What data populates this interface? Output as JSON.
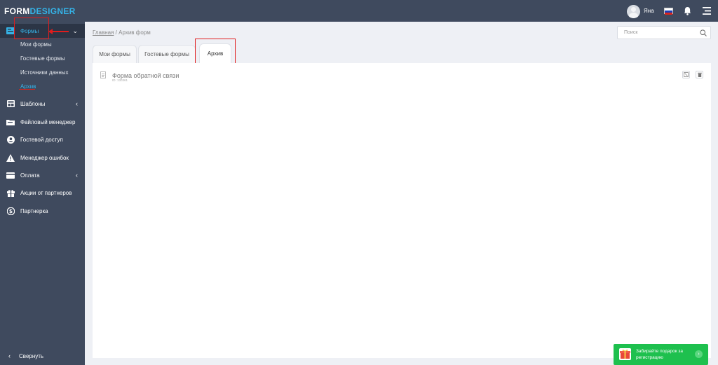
{
  "app": {
    "logo_part1": "FORM",
    "logo_part2": "DESIGNER"
  },
  "topbar": {
    "username": "Яна",
    "icons": [
      "avatar",
      "ru-flag-icon",
      "bell-icon",
      "menu-icon"
    ]
  },
  "sidebar": {
    "items": [
      {
        "label": "Формы",
        "icon": "forms-icon",
        "expanded": true
      },
      {
        "label": "Шаблоны",
        "icon": "templates-icon"
      },
      {
        "label": "Файловый менеджер",
        "icon": "folder-icon"
      },
      {
        "label": "Гостевой доступ",
        "icon": "guest-icon"
      },
      {
        "label": "Менеджер ошибок",
        "icon": "warning-icon"
      },
      {
        "label": "Оплата",
        "icon": "payment-icon"
      },
      {
        "label": "Акции от партнеров",
        "icon": "gift-icon"
      },
      {
        "label": "Партнерка",
        "icon": "dollar-icon"
      }
    ],
    "subitems": [
      "Мои формы",
      "Гостевые формы",
      "Источники данных",
      "Архив"
    ],
    "collapse_label": "Свернуть"
  },
  "breadcrumb": {
    "home": "Главная",
    "separator": " / ",
    "current": "Архив форм"
  },
  "search": {
    "placeholder": "Поиск"
  },
  "tabs": [
    "Мои формы",
    "Гостевые формы",
    "Архив"
  ],
  "active_tab": "Архив",
  "forms": [
    {
      "title": "Форма обратной связи",
      "id_text": "ID: 130361"
    }
  ],
  "promo": {
    "text": "Забирайте подарок за регистрацию"
  },
  "colors": {
    "sidebar_bg": "#3f4a5e",
    "accent": "#35b2e6",
    "annotation": "#e01d1d",
    "promo_bg": "#1ec04e"
  }
}
